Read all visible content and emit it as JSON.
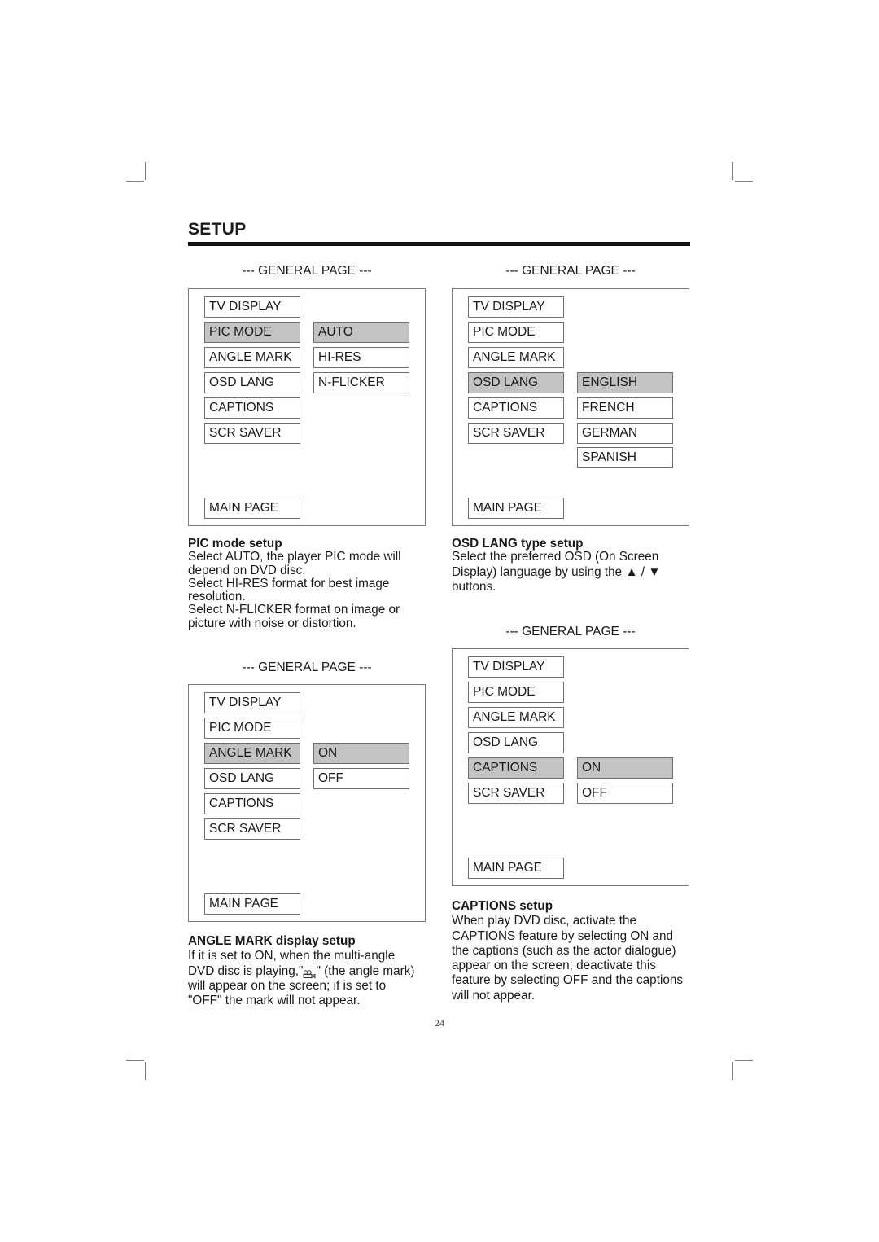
{
  "section_title": "SETUP",
  "page_number": "24",
  "panels": [
    {
      "caption": "--- GENERAL PAGE ---",
      "menu": [
        "TV DISPLAY",
        "PIC MODE",
        "ANGLE MARK",
        "OSD LANG",
        "CAPTIONS",
        "SCR SAVER"
      ],
      "main_page": "MAIN PAGE",
      "selected_item": "PIC MODE",
      "options": [
        "AUTO",
        "HI-RES",
        "N-FLICKER"
      ],
      "selected_option": "AUTO"
    },
    {
      "caption": "--- GENERAL PAGE ---",
      "menu": [
        "TV DISPLAY",
        "PIC MODE",
        "ANGLE MARK",
        "OSD LANG",
        "CAPTIONS",
        "SCR SAVER"
      ],
      "main_page": "MAIN PAGE",
      "selected_item": "OSD LANG",
      "options": [
        "ENGLISH",
        "FRENCH",
        "GERMAN",
        "SPANISH"
      ],
      "selected_option": "ENGLISH"
    },
    {
      "caption": "--- GENERAL PAGE ---",
      "menu": [
        "TV DISPLAY",
        "PIC MODE",
        "ANGLE MARK",
        "OSD LANG",
        "CAPTIONS",
        "SCR SAVER"
      ],
      "main_page": "MAIN PAGE",
      "selected_item": "ANGLE MARK",
      "options": [
        "ON",
        "OFF"
      ],
      "selected_option": "ON"
    },
    {
      "caption": "--- GENERAL PAGE ---",
      "menu": [
        "TV DISPLAY",
        "PIC MODE",
        "ANGLE MARK",
        "OSD LANG",
        "CAPTIONS",
        "SCR SAVER"
      ],
      "main_page": "MAIN PAGE",
      "selected_item": "CAPTIONS",
      "options": [
        "ON",
        "OFF"
      ],
      "selected_option": "ON"
    }
  ],
  "descriptions": {
    "pic_mode": {
      "heading": "PIC mode setup",
      "lines": [
        "Select AUTO, the player PIC mode will",
        "depend on DVD disc.",
        "Select HI-RES format for best image",
        "resolution.",
        "Select N-FLICKER format on image or",
        "picture with noise or distortion."
      ]
    },
    "osd_lang": {
      "heading": "OSD LANG type setup",
      "lines": [
        "Select the preferred OSD (On Screen",
        "Display) language by using the ▲ / ▼",
        "buttons."
      ]
    },
    "angle_mark": {
      "heading": "ANGLE MARK display setup",
      "line1": "If it is set to ON, when the multi-angle",
      "line2_before": "DVD disc is playing,\"",
      "line2_after": "\" (the angle mark)",
      "line3": "will appear on the screen; if is set to",
      "line4": "\"OFF\" the mark will not appear."
    },
    "captions": {
      "heading": "CAPTIONS setup",
      "lines": [
        "When play DVD disc, activate the",
        "CAPTIONS feature by selecting ON and",
        "the captions (such as the actor dialogue)",
        "appear on the screen; deactivate this",
        "feature by selecting OFF and the captions",
        "will not appear."
      ]
    }
  }
}
